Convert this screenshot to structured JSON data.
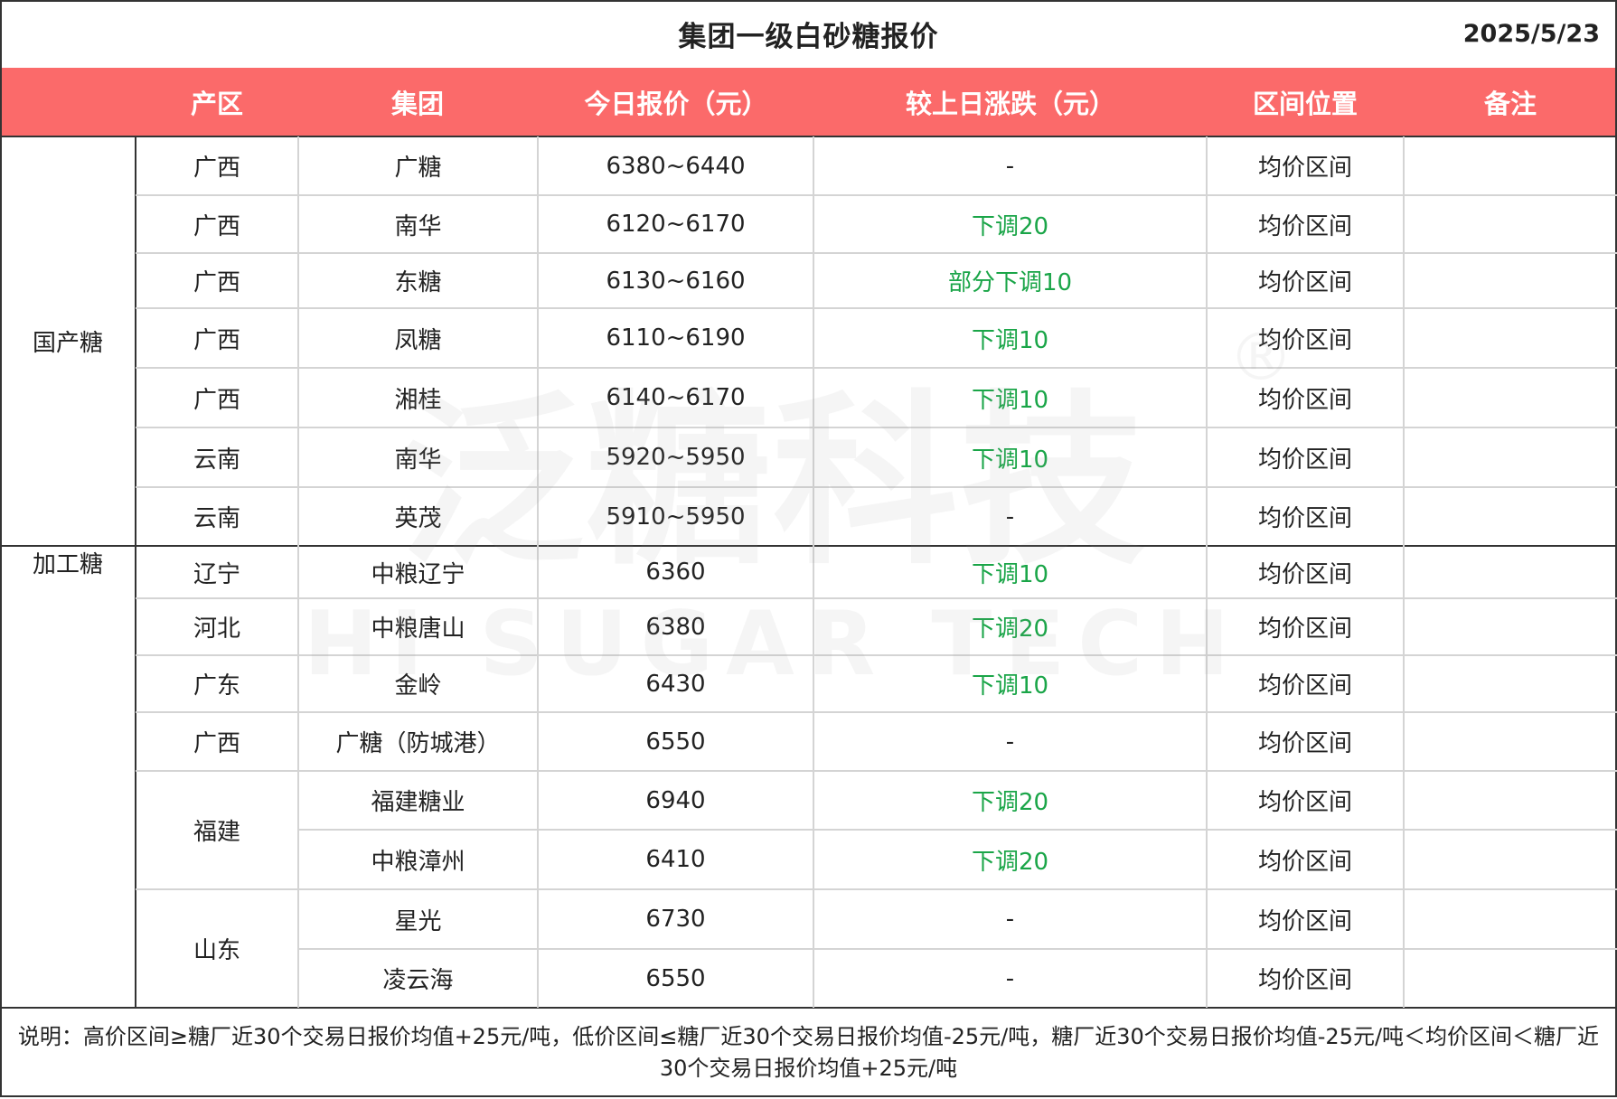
{
  "title": "集团一级白砂糖报价",
  "date": "2025/5/23",
  "header_color": "#fb6a6a",
  "change_color": "#1aa548",
  "columns": [
    "产区",
    "集团",
    "今日报价（元）",
    "较上日涨跌（元）",
    "区间位置",
    "备注"
  ],
  "groups": [
    {
      "name": "国产糖",
      "row_span": 7
    },
    {
      "name": "加工糖",
      "row_span": 9
    }
  ],
  "rows": [
    {
      "region": "广西",
      "company": "广糖",
      "price": "6380~6440",
      "change": "-",
      "position": "均价区间",
      "note": ""
    },
    {
      "region": "广西",
      "company": "南华",
      "price": "6120~6170",
      "change": "下调20",
      "position": "均价区间",
      "note": ""
    },
    {
      "region": "广西",
      "company": "东糖",
      "price": "6130~6160",
      "change": "部分下调10",
      "position": "均价区间",
      "note": ""
    },
    {
      "region": "广西",
      "company": "凤糖",
      "price": "6110~6190",
      "change": "下调10",
      "position": "均价区间",
      "note": ""
    },
    {
      "region": "广西",
      "company": "湘桂",
      "price": "6140~6170",
      "change": "下调10",
      "position": "均价区间",
      "note": ""
    },
    {
      "region": "云南",
      "company": "南华",
      "price": "5920~5950",
      "change": "下调10",
      "position": "均价区间",
      "note": ""
    },
    {
      "region": "云南",
      "company": "英茂",
      "price": "5910~5950",
      "change": "-",
      "position": "均价区间",
      "note": ""
    },
    {
      "region": "辽宁",
      "company": "中粮辽宁",
      "price": "6360",
      "change": "下调10",
      "position": "均价区间",
      "note": ""
    },
    {
      "region": "河北",
      "company": "中粮唐山",
      "price": "6380",
      "change": "下调20",
      "position": "均价区间",
      "note": ""
    },
    {
      "region": "广东",
      "company": "金岭",
      "price": "6430",
      "change": "下调10",
      "position": "均价区间",
      "note": ""
    },
    {
      "region": "广西",
      "company": "广糖（防城港）",
      "price": "6550",
      "change": "-",
      "position": "均价区间",
      "note": ""
    },
    {
      "region": "福建",
      "company": "福建糖业",
      "price": "6940",
      "change": "下调20",
      "position": "均价区间",
      "note": ""
    },
    {
      "region": "",
      "company": "中粮漳州",
      "price": "6410",
      "change": "下调20",
      "position": "均价区间",
      "note": ""
    },
    {
      "region": "山东",
      "company": "星光",
      "price": "6730",
      "change": "-",
      "position": "均价区间",
      "note": ""
    },
    {
      "region": "",
      "company": "凌云海",
      "price": "6550",
      "change": "-",
      "position": "均价区间",
      "note": ""
    }
  ],
  "region_spans": [
    1,
    1,
    1,
    1,
    1,
    1,
    1,
    1,
    1,
    1,
    1,
    2,
    0,
    2,
    0
  ],
  "footnote": "说明：高价区间≥糖厂近30个交易日报价均值+25元/吨，低价区间≤糖厂近30个交易日报价均值-25元/吨，糖厂近30个交易日报价均值-25元/吨＜均价区间＜糖厂近30个交易日报价均值+25元/吨",
  "watermark": {
    "cn": "泛糖科技",
    "en": "HI SUGAR TECH",
    "mark": "®"
  }
}
